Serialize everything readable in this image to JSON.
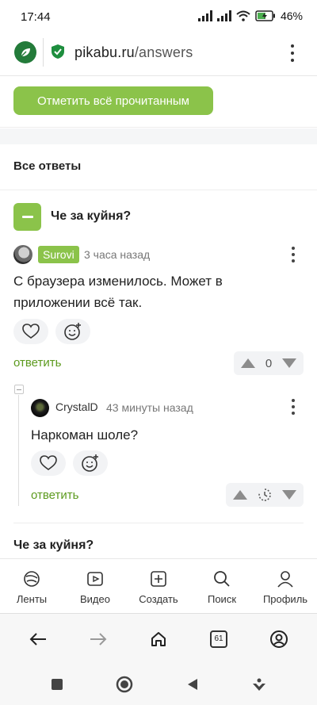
{
  "status_bar": {
    "time": "17:44",
    "battery": "46%"
  },
  "browser": {
    "url_host": "pikabu.ru",
    "url_path": "/answers"
  },
  "page": {
    "mark_read_button": "Отметить всё прочитанным",
    "section_title": "Все ответы",
    "post": {
      "title": "Че за куйня?",
      "comment": {
        "author": "Surovi",
        "time": "3 часа назад",
        "text": "С браузера изменилось. Может в приложении всё так.",
        "reply_label": "ответить",
        "rating": "0"
      },
      "reply": {
        "author": "CrystalD",
        "time": "43 минуты назад",
        "text": "Наркоман шоле?",
        "reply_label": "ответить"
      }
    },
    "next_post_title": "Че за куйня?"
  },
  "app_nav": [
    {
      "label": "Ленты",
      "icon": "feeds-icon"
    },
    {
      "label": "Видео",
      "icon": "video-icon"
    },
    {
      "label": "Создать",
      "icon": "create-icon"
    },
    {
      "label": "Поиск",
      "icon": "search-icon"
    },
    {
      "label": "Профиль",
      "icon": "profile-icon"
    }
  ],
  "browser_nav": {
    "tab_count": "61"
  },
  "colors": {
    "accent": "#8bc34a",
    "link": "#5c9a1e",
    "logo": "#237b3a",
    "shield": "#1e8e3e"
  }
}
